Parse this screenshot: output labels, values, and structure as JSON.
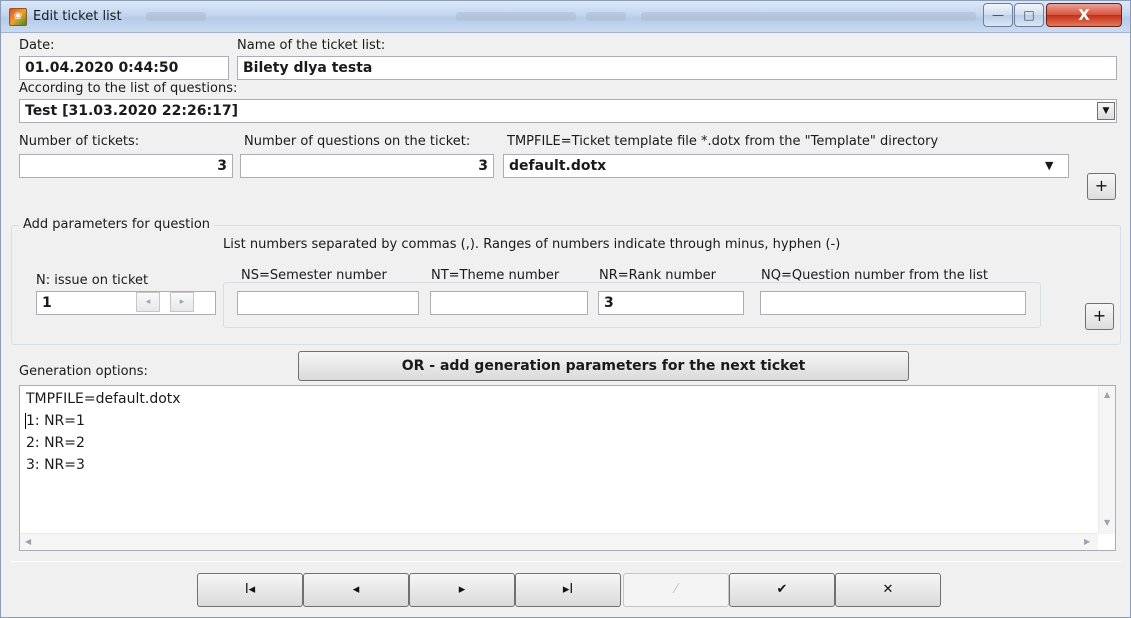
{
  "window": {
    "title": "Edit ticket list",
    "controls": {
      "minimize": "—",
      "maximize": "□",
      "close": "X"
    }
  },
  "header": {
    "date_label": "Date:",
    "date_value": "01.04.2020 0:44:50",
    "name_label": "Name of the ticket list:",
    "name_value": "Bilety dlya testa"
  },
  "questions": {
    "label": "According to the list of questions:",
    "selected": "Test [31.03.2020 22:26:17]"
  },
  "counts": {
    "tickets_label": "Number of tickets:",
    "tickets_value": "3",
    "questions_label": "Number of questions on the ticket:",
    "questions_value": "3",
    "template_label": "TMPFILE=Ticket template file *.dotx from the \"Template\" directory",
    "template_value": "default.dotx",
    "add_label": "+"
  },
  "params": {
    "group_title": "Add parameters for question",
    "hint": "List numbers separated by commas (,). Ranges of numbers indicate through minus, hyphen (-)",
    "n_label": "N: issue on ticket",
    "n_value": "1",
    "ns_label": "NS=Semester number",
    "ns_value": "",
    "nt_label": "NT=Theme number",
    "nt_value": "",
    "nr_label": "NR=Rank number",
    "nr_value": "3",
    "nq_label": "NQ=Question number from the list",
    "nq_value": "",
    "add_label": "+"
  },
  "generation": {
    "label": "Generation options:",
    "next_ticket_button": "OR - add generation parameters for the next ticket",
    "lines": [
      "TMPFILE=default.dotx",
      "1: NR=1",
      "2: NR=2",
      "3: NR=3"
    ]
  },
  "navigator": {
    "first": "I◂",
    "prior": "◂",
    "next": "▸",
    "last": "▸I",
    "edit": "⁄",
    "post": "✔",
    "cancel": "✕"
  }
}
